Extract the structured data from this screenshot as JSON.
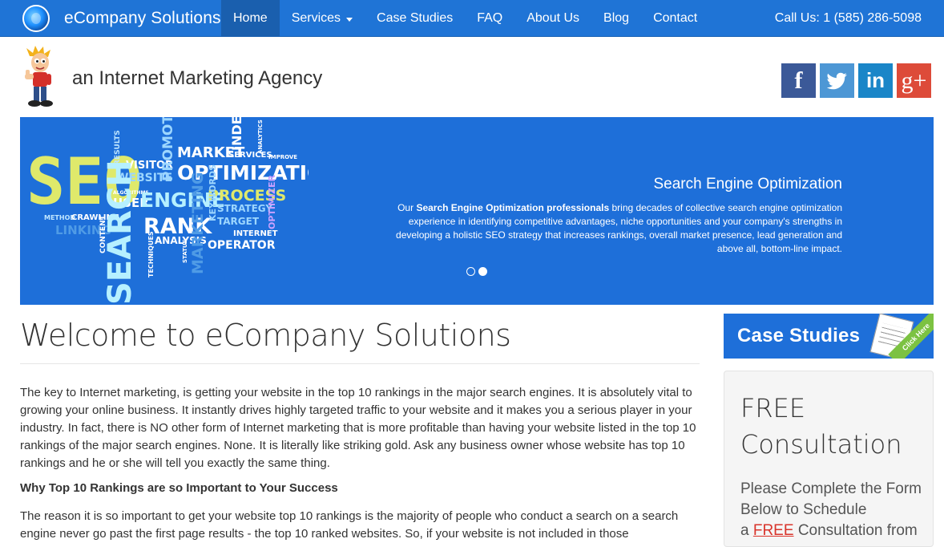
{
  "nav": {
    "brand": "eCompany Solutions",
    "items": [
      {
        "label": "Home",
        "active": true
      },
      {
        "label": "Services",
        "dropdown": true
      },
      {
        "label": "Case Studies"
      },
      {
        "label": "FAQ"
      },
      {
        "label": "About Us"
      },
      {
        "label": "Blog"
      },
      {
        "label": "Contact"
      }
    ],
    "phone": "Call Us: 1 (585) 286-5098"
  },
  "header": {
    "tagline": "an Internet Marketing Agency",
    "social": [
      "f",
      "t",
      "in",
      "g+"
    ]
  },
  "hero": {
    "title": "Search Engine Optimization",
    "text_prefix": "Our ",
    "text_bold": "Search Engine Optimization professionals",
    "text_rest": " bring decades of collective search engine optimization experience in identifying competitive advantages, niche opportunities and your company's strengths in developing a holistic SEO strategy that increases rankings, overall market presence, lead generation and above all, bottom-line impact.",
    "art_words": [
      "SEO",
      "RESULTS",
      "VISITOR",
      "WEBSITE",
      "PROMOTION",
      "MARKET",
      "SERVICES",
      "INDEX",
      "ANALYTICS",
      "IMPROVE",
      "OPTIMIZATION",
      "ALGORITHMS",
      "USER",
      "ENGINE",
      "PROCESS",
      "METHOD",
      "CRAWLING",
      "RANK",
      "STRATEGY",
      "OPTIMIZER",
      "LINKING",
      "CONTENT",
      "SEARCH",
      "TARGET",
      "ANALYSIS",
      "KEYWORDS",
      "INTERNET",
      "MARKETING",
      "TECHNIQUES",
      "STATUS",
      "OPERATOR"
    ]
  },
  "main": {
    "title": "Welcome to eCompany Solutions",
    "p1": "The key to Internet marketing, is getting your website in the top 10 rankings in the major search engines. It is absolutely vital to growing your online business. It instantly drives highly targeted traffic to your website and it makes you a serious player in your industry. In fact, there is NO other form of Internet marketing that is more profitable than having your website listed in the top 10 rankings of the major search engines. None. It is literally like striking gold. Ask any business owner whose website has top 10 rankings and he or she will tell you exactly the same thing.",
    "subhead": "Why Top 10 Rankings are so Important to Your Success",
    "p2": "The reason it is so important to get your website top 10 rankings is the majority of people who conduct a search on a search engine never go past the first page results - the top 10 ranked websites. So, if your website is not included in those"
  },
  "sidebar": {
    "case_studies": "Case Studies",
    "click_here": "Click Here",
    "consult_title": "FREE Consultation",
    "consult_text_1": "Please Complete the Form Below to Schedule",
    "consult_text_2": "a ",
    "consult_free": "FREE",
    "consult_text_3": " Consultation from"
  },
  "colors": {
    "nav": "#1f74d6",
    "nav_active": "#1a5fae",
    "hero": "#1e6fd9",
    "accent_red": "#d9342b"
  }
}
